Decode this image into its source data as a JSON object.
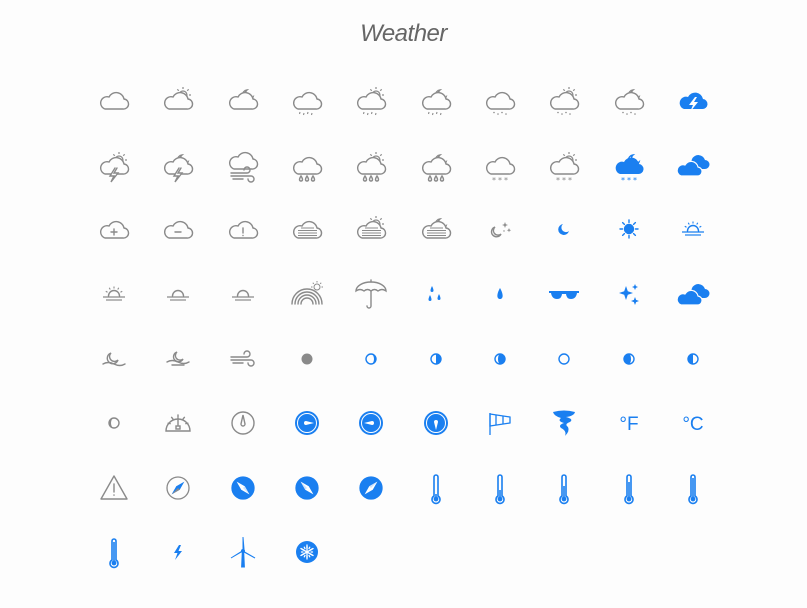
{
  "title": "Weather",
  "colors": {
    "gray": "#8a8a8a",
    "blue": "#1a7ff0"
  },
  "icons": [
    {
      "name": "cloud",
      "c": "gray",
      "parts": [
        "cloud"
      ]
    },
    {
      "name": "cloud-sun",
      "c": "gray",
      "parts": [
        "sunsmall",
        "cloud"
      ]
    },
    {
      "name": "cloud-moon",
      "c": "gray",
      "parts": [
        "moonsmall",
        "cloud"
      ]
    },
    {
      "name": "cloud-drizzle",
      "c": "gray",
      "parts": [
        "cloud",
        "drizzle"
      ]
    },
    {
      "name": "cloud-drizzle-sun",
      "c": "gray",
      "parts": [
        "sunsmall",
        "cloud",
        "drizzle"
      ]
    },
    {
      "name": "cloud-drizzle-moon",
      "c": "gray",
      "parts": [
        "moonsmall",
        "cloud",
        "drizzle"
      ]
    },
    {
      "name": "cloud-hail",
      "c": "gray",
      "parts": [
        "cloud",
        "hail"
      ]
    },
    {
      "name": "cloud-hail-sun",
      "c": "gray",
      "parts": [
        "sunsmall",
        "cloud",
        "hail"
      ]
    },
    {
      "name": "cloud-hail-moon",
      "c": "gray",
      "parts": [
        "moonsmall",
        "cloud",
        "hail"
      ]
    },
    {
      "name": "cloud-lightning-filled",
      "c": "blue",
      "parts": [
        "cloudfill",
        "boltwhite"
      ]
    },
    {
      "name": "cloud-lightning-sun",
      "c": "gray",
      "parts": [
        "sunsmall",
        "cloud",
        "bolt"
      ]
    },
    {
      "name": "cloud-lightning-moon",
      "c": "gray",
      "parts": [
        "moonsmall",
        "cloud",
        "bolt"
      ]
    },
    {
      "name": "cloud-wind",
      "c": "gray",
      "parts": [
        "cloudhigh",
        "wind"
      ]
    },
    {
      "name": "cloud-rain",
      "c": "gray",
      "parts": [
        "cloud",
        "raindrops"
      ]
    },
    {
      "name": "cloud-rain-sun",
      "c": "gray",
      "parts": [
        "sunsmall",
        "cloud",
        "raindrops"
      ]
    },
    {
      "name": "cloud-rain-moon",
      "c": "gray",
      "parts": [
        "moonsmall",
        "cloud",
        "raindrops"
      ]
    },
    {
      "name": "cloud-snow",
      "c": "gray",
      "parts": [
        "cloud",
        "snow"
      ]
    },
    {
      "name": "cloud-snow-sun",
      "c": "gray",
      "parts": [
        "sunsmall",
        "cloud",
        "snow"
      ]
    },
    {
      "name": "cloud-snow-moon-filled",
      "c": "blue",
      "parts": [
        "moonsmall",
        "cloudfill",
        "snow"
      ]
    },
    {
      "name": "clouds-filled",
      "c": "blue",
      "parts": [
        "cloudsfill"
      ]
    },
    {
      "name": "cloud-plus",
      "c": "gray",
      "parts": [
        "cloud",
        "plus"
      ]
    },
    {
      "name": "cloud-minus",
      "c": "gray",
      "parts": [
        "cloud",
        "minus"
      ]
    },
    {
      "name": "cloud-alert",
      "c": "gray",
      "parts": [
        "cloud",
        "alert"
      ]
    },
    {
      "name": "cloud-fog",
      "c": "gray",
      "parts": [
        "cloud",
        "fog"
      ]
    },
    {
      "name": "cloud-fog-sun",
      "c": "gray",
      "parts": [
        "sunsmall",
        "cloud",
        "fog"
      ]
    },
    {
      "name": "cloud-fog-moon",
      "c": "gray",
      "parts": [
        "moonsmall",
        "cloud",
        "fog"
      ]
    },
    {
      "name": "moon-stars",
      "c": "gray",
      "parts": [
        "moonstars"
      ]
    },
    {
      "name": "moon",
      "c": "blue",
      "parts": [
        "moonfill"
      ]
    },
    {
      "name": "sun",
      "c": "blue",
      "parts": [
        "sunfill"
      ]
    },
    {
      "name": "sunrise-filled",
      "c": "blue",
      "parts": [
        "horizon",
        "halfsun",
        "rays"
      ]
    },
    {
      "name": "sunrise",
      "c": "gray",
      "parts": [
        "horizon",
        "halfsun",
        "rays",
        "arrowup"
      ]
    },
    {
      "name": "sunset",
      "c": "gray",
      "parts": [
        "horizon",
        "halfsun",
        "arrowdown"
      ]
    },
    {
      "name": "horizon",
      "c": "gray",
      "parts": [
        "horizon",
        "halfsun"
      ]
    },
    {
      "name": "rainbow",
      "c": "gray",
      "parts": [
        "rainbow"
      ]
    },
    {
      "name": "umbrella",
      "c": "gray",
      "parts": [
        "umbrella"
      ]
    },
    {
      "name": "raindrops",
      "c": "blue",
      "parts": [
        "drops"
      ]
    },
    {
      "name": "raindrop",
      "c": "blue",
      "parts": [
        "drop"
      ]
    },
    {
      "name": "sunglasses",
      "c": "blue",
      "parts": [
        "glasses"
      ]
    },
    {
      "name": "stars",
      "c": "blue",
      "parts": [
        "stars"
      ]
    },
    {
      "name": "clouds",
      "c": "blue",
      "parts": [
        "cloudsfill"
      ]
    },
    {
      "name": "moonrise",
      "c": "gray",
      "parts": [
        "moonrise"
      ]
    },
    {
      "name": "moonset",
      "c": "gray",
      "parts": [
        "moonset"
      ]
    },
    {
      "name": "wind",
      "c": "gray",
      "parts": [
        "windonly"
      ]
    },
    {
      "name": "moon-new",
      "c": "gray",
      "parts": [
        "phase:new"
      ]
    },
    {
      "name": "moon-waxing-crescent",
      "c": "blue",
      "parts": [
        "phase:wxc"
      ]
    },
    {
      "name": "moon-first-quarter",
      "c": "blue",
      "parts": [
        "phase:fq"
      ]
    },
    {
      "name": "moon-waxing-gibbous",
      "c": "blue",
      "parts": [
        "phase:wxg"
      ]
    },
    {
      "name": "moon-full",
      "c": "blue",
      "parts": [
        "phase:full"
      ]
    },
    {
      "name": "moon-waning-gibbous",
      "c": "blue",
      "parts": [
        "phase:wng"
      ]
    },
    {
      "name": "moon-last-quarter",
      "c": "blue",
      "parts": [
        "phase:lq"
      ]
    },
    {
      "name": "moon-waning-crescent",
      "c": "gray",
      "parts": [
        "phase:wnc"
      ]
    },
    {
      "name": "barometer",
      "c": "gray",
      "parts": [
        "barometer"
      ]
    },
    {
      "name": "compass",
      "c": "gray",
      "parts": [
        "compass"
      ]
    },
    {
      "name": "compass-east",
      "c": "blue",
      "parts": [
        "compassfill:90"
      ]
    },
    {
      "name": "compass-west",
      "c": "blue",
      "parts": [
        "compassfill:270"
      ]
    },
    {
      "name": "compass-south",
      "c": "blue",
      "parts": [
        "compassfill:180"
      ]
    },
    {
      "name": "windsock",
      "c": "blue",
      "parts": [
        "windsock"
      ]
    },
    {
      "name": "tornado",
      "c": "blue",
      "parts": [
        "tornado"
      ]
    },
    {
      "name": "fahrenheit",
      "c": "blue",
      "parts": [
        "text"
      ],
      "label": "°F"
    },
    {
      "name": "celsius",
      "c": "blue",
      "parts": [
        "text"
      ],
      "label": "°C"
    },
    {
      "name": "warning",
      "c": "gray",
      "parts": [
        "warning"
      ]
    },
    {
      "name": "compass-northeast",
      "c": "gray",
      "parts": [
        "compassrose:45"
      ]
    },
    {
      "name": "compass-northwest",
      "c": "blue",
      "parts": [
        "compassrose:315"
      ]
    },
    {
      "name": "compass-southeast",
      "c": "blue",
      "parts": [
        "compassrose:135"
      ]
    },
    {
      "name": "compass-southwest",
      "c": "blue",
      "parts": [
        "compassrose:225"
      ]
    },
    {
      "name": "thermometer-empty",
      "c": "blue",
      "parts": [
        "thermo:0"
      ]
    },
    {
      "name": "thermometer-low",
      "c": "blue",
      "parts": [
        "thermo:0.25"
      ]
    },
    {
      "name": "thermometer-medium",
      "c": "blue",
      "parts": [
        "thermo:0.5"
      ]
    },
    {
      "name": "thermometer-high",
      "c": "blue",
      "parts": [
        "thermo:0.75"
      ]
    },
    {
      "name": "thermometer-full",
      "c": "blue",
      "parts": [
        "thermo:1"
      ]
    },
    {
      "name": "thermometer-max",
      "c": "blue",
      "parts": [
        "thermo:1"
      ]
    },
    {
      "name": "lightning",
      "c": "blue",
      "parts": [
        "boltsolo"
      ]
    },
    {
      "name": "wind-turbine",
      "c": "blue",
      "parts": [
        "turbine"
      ]
    },
    {
      "name": "snowflake",
      "c": "blue",
      "parts": [
        "snowflake"
      ]
    }
  ]
}
